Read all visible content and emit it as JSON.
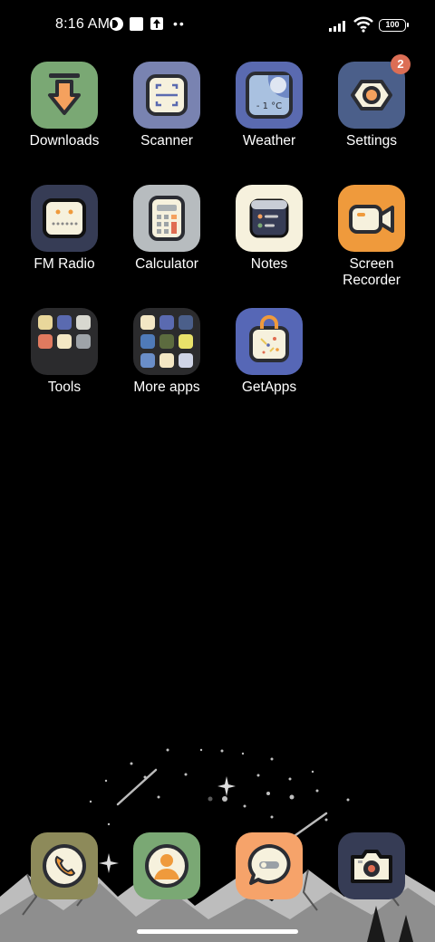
{
  "status_bar": {
    "time": "8:16 AM",
    "battery": "100",
    "icons": [
      "data-saver-icon",
      "square-notification-icon",
      "upload-icon",
      "more-notifications-icon",
      "signal-icon",
      "wifi-icon",
      "battery-icon"
    ]
  },
  "apps": {
    "downloads": {
      "label": "Downloads",
      "icon": "download-arrow-icon",
      "bg": "#7aa874"
    },
    "scanner": {
      "label": "Scanner",
      "icon": "scan-frame-icon",
      "bg": "#7983b1"
    },
    "weather": {
      "label": "Weather",
      "icon": "weather-moon-icon",
      "bg": "#5a6ab0",
      "temp": "- 1 °C"
    },
    "settings": {
      "label": "Settings",
      "icon": "gear-icon",
      "bg": "#4b5f8a",
      "badge": "2"
    },
    "fm_radio": {
      "label": "FM Radio",
      "icon": "radio-icon",
      "bg": "#363c55"
    },
    "calculator": {
      "label": "Calculator",
      "icon": "calculator-icon",
      "bg": "#b7bcbf"
    },
    "notes": {
      "label": "Notes",
      "icon": "notes-icon",
      "bg": "#f6f1dd"
    },
    "screen_recorder": {
      "label": "Screen\nRecorder",
      "label_line1": "Screen",
      "label_line2": "Recorder",
      "icon": "video-camera-icon",
      "bg": "#ef9a3c"
    },
    "tools": {
      "label": "Tools",
      "icon": "folder-icon"
    },
    "more_apps": {
      "label": "More apps",
      "icon": "folder-icon"
    },
    "getapps": {
      "label": "GetApps",
      "icon": "shopping-bag-icon",
      "bg": "#5667b6"
    }
  },
  "dock": {
    "phone": {
      "icon": "phone-icon",
      "bg": "#8d8a5a"
    },
    "contacts": {
      "icon": "contact-person-icon",
      "bg": "#7aa874"
    },
    "messages": {
      "icon": "chat-bubble-icon",
      "bg": "#f6a36a"
    },
    "camera": {
      "icon": "camera-icon",
      "bg": "#363c55"
    }
  }
}
